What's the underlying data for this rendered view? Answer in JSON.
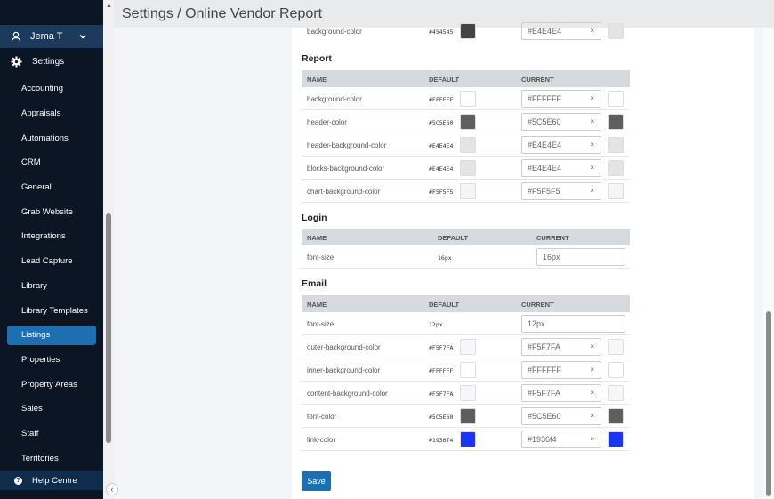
{
  "header": {
    "title": "Settings / Online Vendor Report"
  },
  "sidebar": {
    "user": "Jema T",
    "settings_label": "Settings",
    "items": [
      "Accounting",
      "Appraisals",
      "Automations",
      "CRM",
      "General",
      "Grab Website",
      "Integrations",
      "Lead Capture",
      "Library",
      "Library Templates",
      "Listings",
      "Properties",
      "Property Areas",
      "Sales",
      "Staff",
      "Territories"
    ],
    "active_item": "Listings",
    "help": "Help Centre"
  },
  "top_row": {
    "name": "background-color",
    "default": "#454545",
    "current": "#E4E4E4",
    "default_color": "#454545",
    "current_color": "#E4E4E4"
  },
  "columns": {
    "name": "NAME",
    "default": "DEFAULT",
    "current": "CURRENT"
  },
  "report": {
    "title": "Report",
    "rows": [
      {
        "name": "background-color",
        "default": "#FFFFFF",
        "current": "#FFFFFF",
        "color": "#FFFFFF"
      },
      {
        "name": "header-color",
        "default": "#5C5E60",
        "current": "#5C5E60",
        "color": "#5C5E60"
      },
      {
        "name": "header-background-color",
        "default": "#E4E4E4",
        "current": "#E4E4E4",
        "color": "#E4E4E4"
      },
      {
        "name": "blocks-background-color",
        "default": "#E4E4E4",
        "current": "#E4E4E4",
        "color": "#E4E4E4"
      },
      {
        "name": "chart-background-color",
        "default": "#F5F5F5",
        "current": "#F5F5F5",
        "color": "#F5F5F5"
      }
    ]
  },
  "login": {
    "title": "Login",
    "rows": [
      {
        "name": "font-size",
        "default": "16px",
        "current": "16px"
      }
    ]
  },
  "email": {
    "title": "Email",
    "font_size": {
      "name": "font-size",
      "default": "12px",
      "current": "12px"
    },
    "rows": [
      {
        "name": "outer-background-color",
        "default": "#F5F7FA",
        "current": "#F5F7FA",
        "color": "#F5F7FA"
      },
      {
        "name": "inner-background-color",
        "default": "#FFFFFF",
        "current": "#FFFFFF",
        "color": "#FFFFFF"
      },
      {
        "name": "content-background-color",
        "default": "#F5F7FA",
        "current": "#F5F7FA",
        "color": "#F5F7FA"
      },
      {
        "name": "font-color",
        "default": "#5C5E60",
        "current": "#5C5E60",
        "color": "#5C5E60"
      },
      {
        "name": "link-color",
        "default": "#1936f4",
        "current": "#1936f4",
        "color": "#1936f4"
      }
    ]
  },
  "save_label": "Save",
  "clear_glyph": "×"
}
